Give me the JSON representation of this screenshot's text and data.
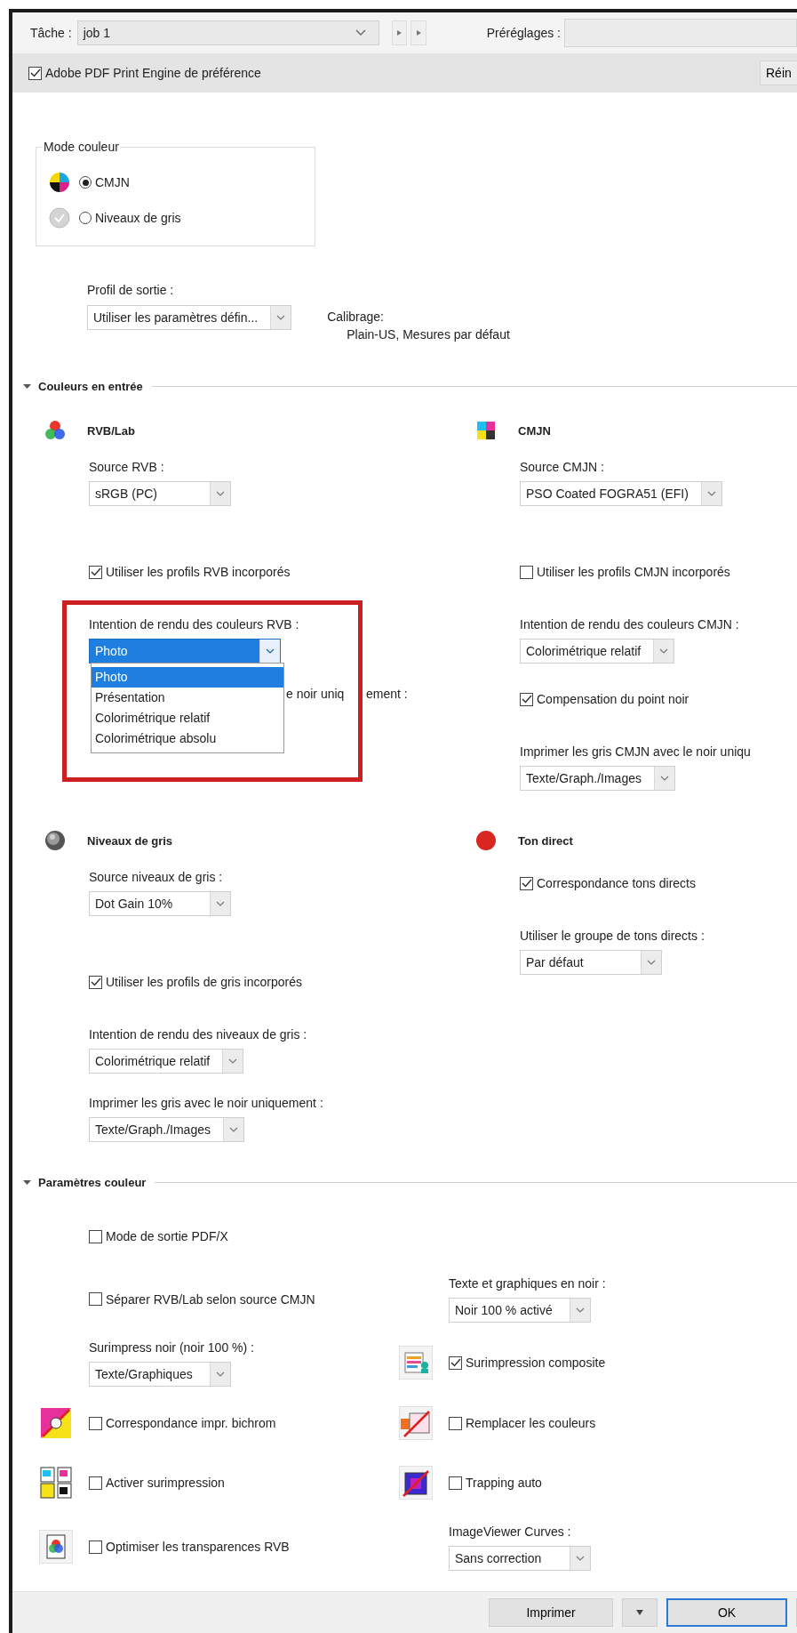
{
  "toolbar": {
    "task_label": "Tâche :",
    "task_value": "job 1",
    "presets_label": "Préréglages :"
  },
  "engine_option": {
    "label": "Adobe PDF Print Engine de préférence",
    "checked": true
  },
  "reset_button": "Réin",
  "color_mode": {
    "title": "Mode couleur",
    "options": [
      {
        "kind": "cmyk",
        "label": "CMJN",
        "selected": true
      },
      {
        "kind": "gray",
        "label": "Niveaux de gris",
        "selected": false
      }
    ]
  },
  "output_profile": {
    "label": "Profil de sortie :",
    "value": "Utiliser les paramètres défin..."
  },
  "calibration": {
    "label": "Calibrage:",
    "value": "Plain-US, Mesures par défaut"
  },
  "input_colors": {
    "title": "Couleurs en entrée",
    "expanded": true,
    "groups": [
      {
        "kind": "rgb",
        "title": "RVB/Lab",
        "items": [
          {
            "kind": "select",
            "label": "Source RVB :",
            "value": "sRGB (PC)"
          },
          {
            "kind": "checkbox",
            "label": "Utiliser les profils RVB incorporés",
            "checked": true
          },
          {
            "kind": "dropdown",
            "label": "Intention de rendu des couleurs RVB :",
            "value": "Photo",
            "highlighted": true,
            "covered_label_parts": [
              "e noir uniq",
              "ement :"
            ],
            "options": [
              {
                "label": "Photo",
                "selected": true
              },
              {
                "label": "Présentation",
                "selected": false
              },
              {
                "label": "Colorimétrique relatif",
                "selected": false
              },
              {
                "label": "Colorimétrique absolu",
                "selected": false
              }
            ]
          }
        ]
      },
      {
        "kind": "cmyk",
        "title": "CMJN",
        "items": [
          {
            "kind": "select",
            "label": "Source CMJN :",
            "value": "PSO Coated FOGRA51 (EFI)"
          },
          {
            "kind": "checkbox",
            "label": "Utiliser les profils CMJN incorporés",
            "checked": false
          },
          {
            "kind": "select",
            "label": "Intention de rendu des couleurs CMJN :",
            "value": "Colorimétrique relatif"
          },
          {
            "kind": "checkbox",
            "label": "Compensation du point noir",
            "checked": true
          },
          {
            "kind": "select",
            "label": "Imprimer les gris CMJN avec le noir uniqu",
            "value": "Texte/Graph./Images"
          }
        ]
      },
      {
        "kind": "gray",
        "title": "Niveaux de gris",
        "items": [
          {
            "kind": "select",
            "label": "Source niveaux de gris :",
            "value": "Dot Gain 10%"
          },
          {
            "kind": "checkbox",
            "label": "Utiliser les profils de gris incorporés",
            "checked": true
          },
          {
            "kind": "select",
            "label": "Intention de rendu des niveaux de gris :",
            "value": "Colorimétrique relatif"
          },
          {
            "kind": "select",
            "label": "Imprimer les gris avec le noir uniquement :",
            "value": "Texte/Graph./Images"
          }
        ]
      },
      {
        "kind": "spot",
        "title": "Ton direct",
        "items": [
          {
            "kind": "checkbox",
            "label": "Correspondance tons directs",
            "checked": true
          },
          {
            "kind": "select",
            "label": "Utiliser le groupe de tons directs :",
            "value": "Par défaut"
          }
        ]
      }
    ]
  },
  "color_settings": {
    "title": "Paramètres couleur",
    "expanded": true,
    "rows": [
      {
        "left": {
          "kind": "checkbox",
          "label": "Mode de sortie PDF/X",
          "checked": false
        }
      },
      {
        "left": {
          "kind": "checkbox",
          "label": "Séparer RVB/Lab selon source CMJN",
          "checked": false
        },
        "right": {
          "kind": "select",
          "label": "Texte et graphiques en noir :",
          "value": "Noir 100 % activé"
        }
      },
      {
        "left": {
          "kind": "select",
          "label": "Surimpress noir (noir 100 %) :",
          "value": "Texte/Graphiques"
        },
        "right": {
          "kind": "checkbox",
          "label": "Surimpression composite",
          "checked": true
        }
      },
      {
        "left": {
          "kind": "checkbox",
          "label": "Correspondance impr. bichrom",
          "checked": false
        },
        "right": {
          "kind": "checkbox",
          "label": "Remplacer les couleurs",
          "checked": false
        }
      },
      {
        "left": {
          "kind": "checkbox",
          "label": "Activer surimpression",
          "checked": false
        },
        "right": {
          "kind": "checkbox",
          "label": "Trapping auto",
          "checked": false
        }
      },
      {
        "left": {
          "kind": "checkbox",
          "label": "Optimiser les transparences RVB",
          "checked": false
        },
        "right": {
          "kind": "select",
          "label": "ImageViewer Curves :",
          "value": "Sans correction"
        }
      }
    ]
  },
  "footer": {
    "print_button": "Imprimer",
    "ok_button": "OK"
  }
}
